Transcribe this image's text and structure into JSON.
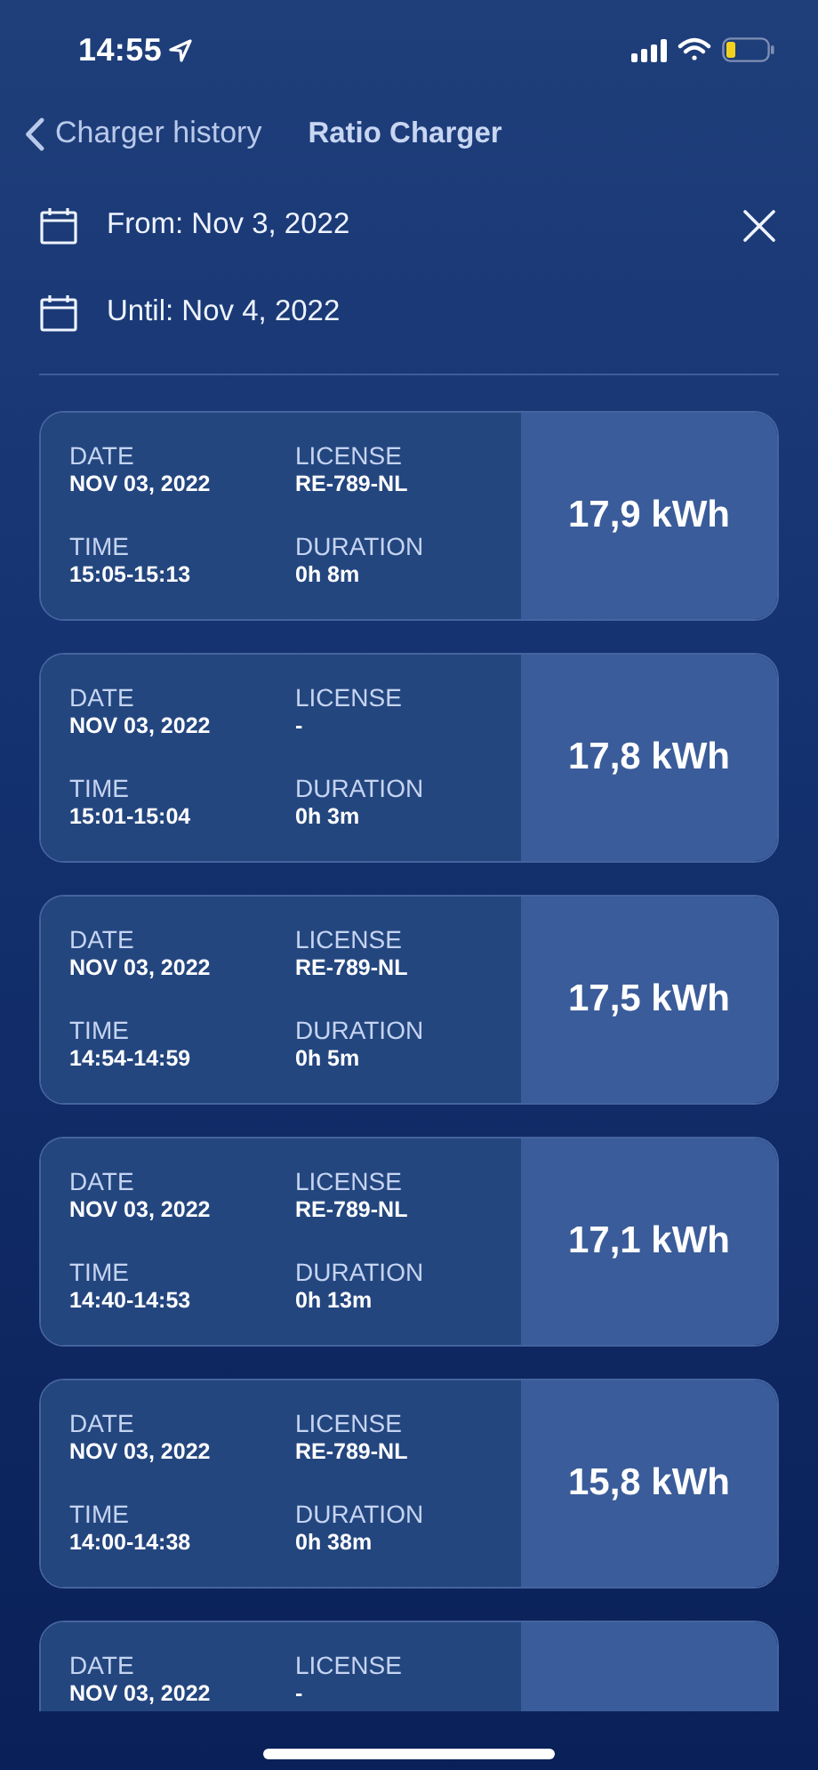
{
  "status_bar": {
    "time": "14:55"
  },
  "nav": {
    "back_label": "Charger history",
    "title": "Ratio Charger"
  },
  "filters": [
    {
      "label": "From: Nov 3, 2022",
      "clearable": true
    },
    {
      "label": "Until: Nov 4, 2022",
      "clearable": false
    }
  ],
  "sessions": [
    {
      "fields": [
        {
          "label": "DATE",
          "value": "NOV 03, 2022"
        },
        {
          "label": "LICENSE",
          "value": "RE-789-NL"
        },
        {
          "label": "TIME",
          "value": "15:05-15:13"
        },
        {
          "label": "DURATION",
          "value": "0h 8m"
        }
      ],
      "energy": "17,9 kWh"
    },
    {
      "fields": [
        {
          "label": "DATE",
          "value": "NOV 03, 2022"
        },
        {
          "label": "LICENSE",
          "value": "-"
        },
        {
          "label": "TIME",
          "value": "15:01-15:04"
        },
        {
          "label": "DURATION",
          "value": "0h 3m"
        }
      ],
      "energy": "17,8 kWh"
    },
    {
      "fields": [
        {
          "label": "DATE",
          "value": "NOV 03, 2022"
        },
        {
          "label": "LICENSE",
          "value": "RE-789-NL"
        },
        {
          "label": "TIME",
          "value": "14:54-14:59"
        },
        {
          "label": "DURATION",
          "value": "0h 5m"
        }
      ],
      "energy": "17,5 kWh"
    },
    {
      "fields": [
        {
          "label": "DATE",
          "value": "NOV 03, 2022"
        },
        {
          "label": "LICENSE",
          "value": "RE-789-NL"
        },
        {
          "label": "TIME",
          "value": "14:40-14:53"
        },
        {
          "label": "DURATION",
          "value": "0h 13m"
        }
      ],
      "energy": "17,1 kWh"
    },
    {
      "fields": [
        {
          "label": "DATE",
          "value": "NOV 03, 2022"
        },
        {
          "label": "LICENSE",
          "value": "RE-789-NL"
        },
        {
          "label": "TIME",
          "value": "14:00-14:38"
        },
        {
          "label": "DURATION",
          "value": "0h 38m"
        }
      ],
      "energy": "15,8 kWh"
    },
    {
      "fields": [
        {
          "label": "DATE",
          "value": "NOV 03, 2022"
        },
        {
          "label": "LICENSE",
          "value": "-"
        }
      ]
    }
  ]
}
